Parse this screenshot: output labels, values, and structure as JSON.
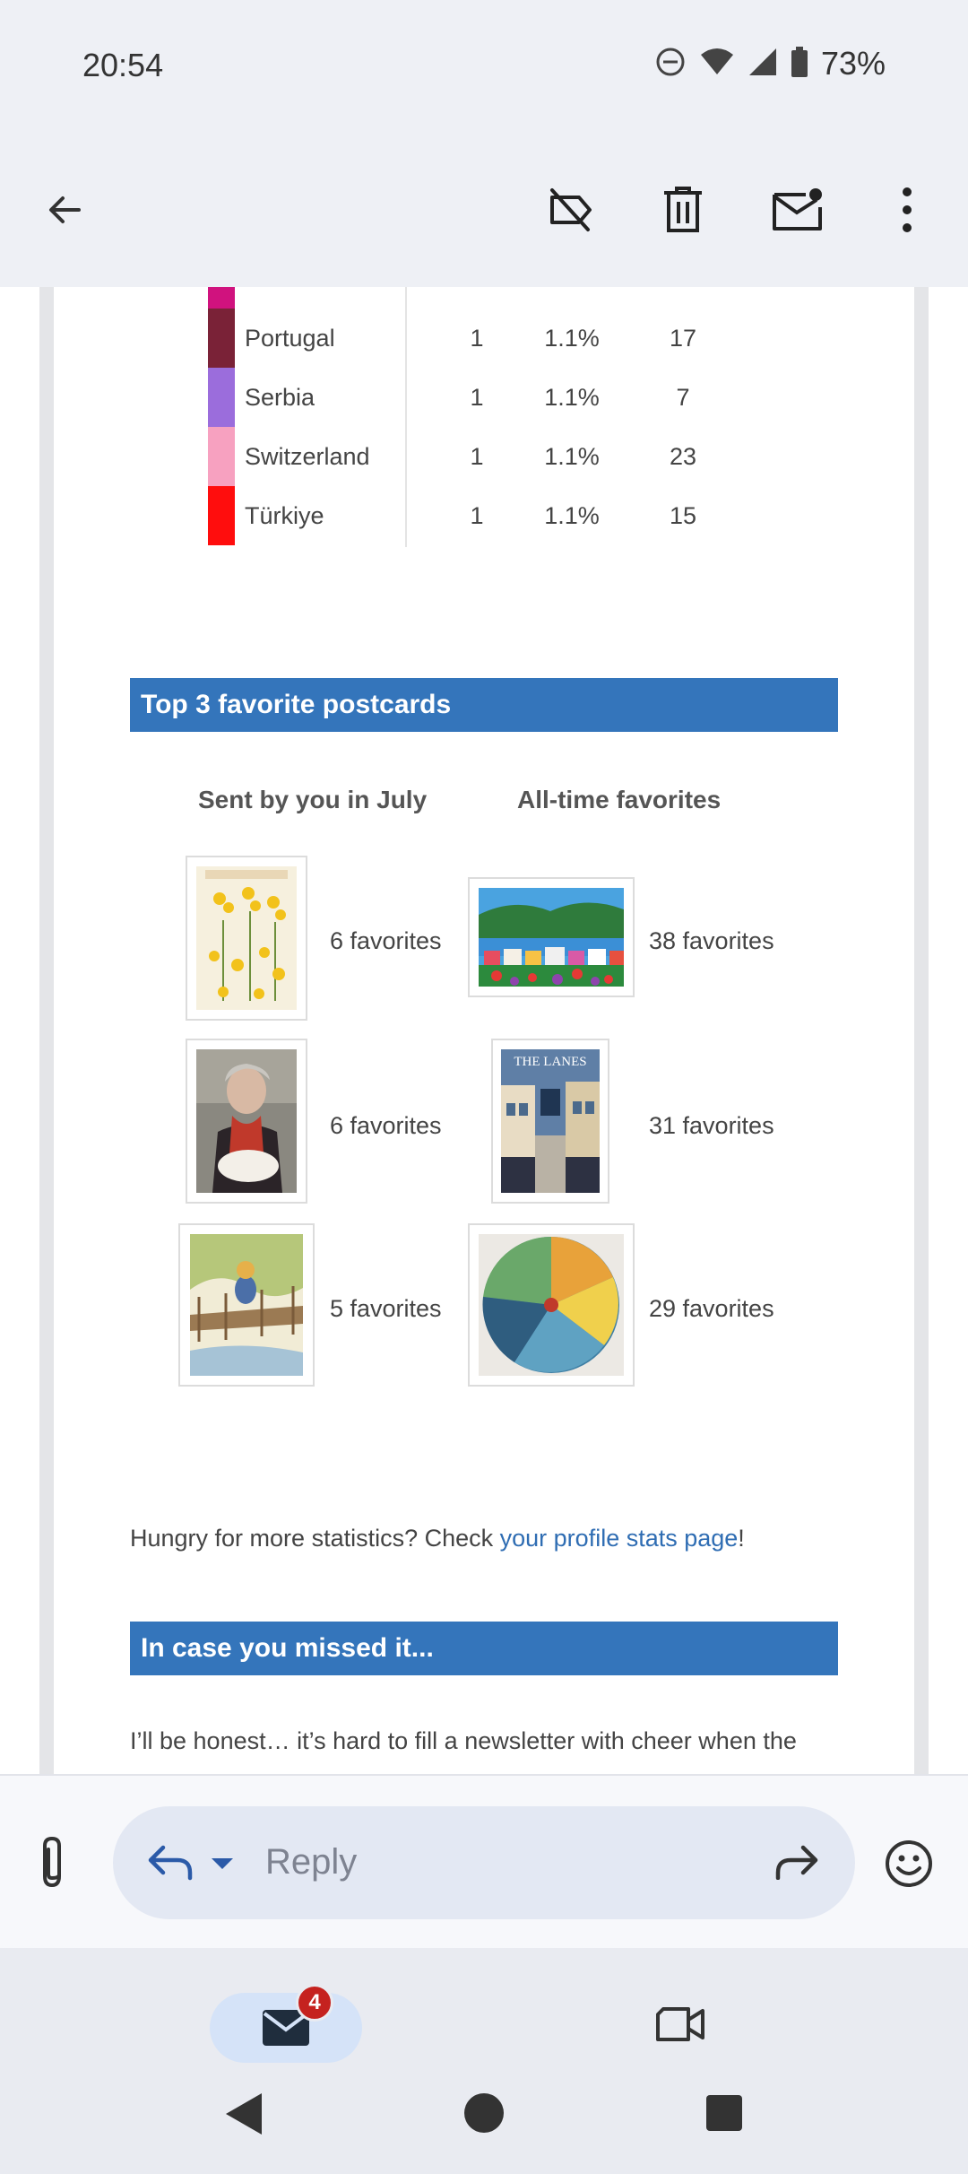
{
  "status": {
    "time": "20:54",
    "battery": "73%"
  },
  "stats": {
    "rows": [
      {
        "country": "Portugal",
        "count": "1",
        "percent": "1.1%",
        "days": "17",
        "color": "#7a2237"
      },
      {
        "country": "Serbia",
        "count": "1",
        "percent": "1.1%",
        "days": "7",
        "color": "#9b6ddc"
      },
      {
        "country": "Switzerland",
        "count": "1",
        "percent": "1.1%",
        "days": "23",
        "color": "#f7a1c0"
      },
      {
        "country": "Türkiye",
        "count": "1",
        "percent": "1.1%",
        "days": "15",
        "color": "#ff0d0d"
      }
    ],
    "partial_row_color": "#d0127e"
  },
  "favorites": {
    "header": "Top 3 favorite postcards",
    "col_sent": "Sent by you in July",
    "col_alltime": "All-time favorites",
    "sent": [
      {
        "label": "6 favorites"
      },
      {
        "label": "6 favorites"
      },
      {
        "label": "5 favorites"
      }
    ],
    "alltime": [
      {
        "label": "38 favorites"
      },
      {
        "label": "31 favorites",
        "card_text": "THE LANES"
      },
      {
        "label": "29 favorites"
      }
    ]
  },
  "more_stats": {
    "prefix": "Hungry for more statistics? Check ",
    "link": "your profile stats page",
    "suffix": "!"
  },
  "missed": {
    "header": "In case you missed it...",
    "text": "I’ll be honest… it’s hard to fill a newsletter with cheer when the"
  },
  "reply": {
    "placeholder": "Reply"
  },
  "nav": {
    "mail_badge": "4"
  }
}
